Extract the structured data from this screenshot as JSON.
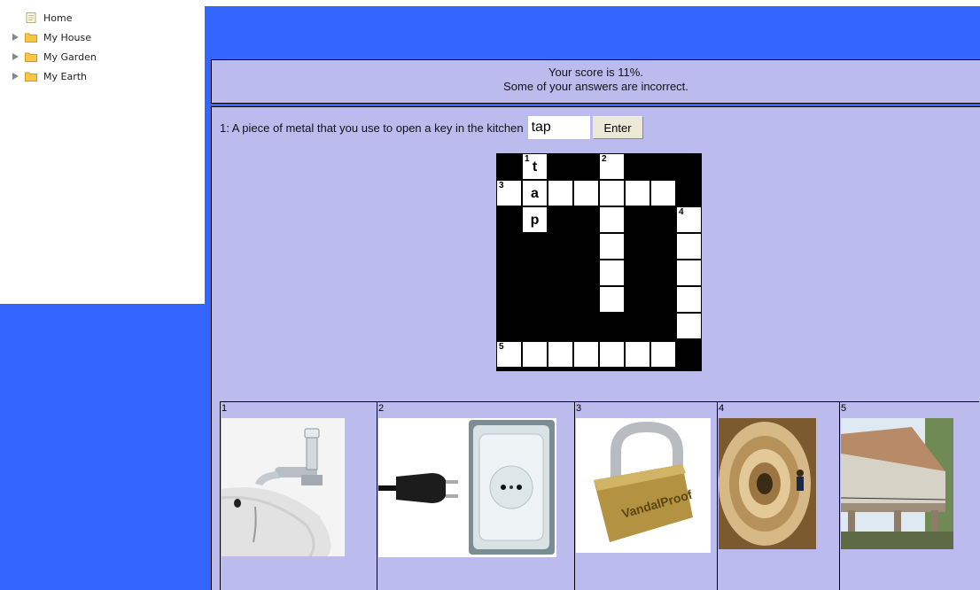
{
  "nav": {
    "items": [
      {
        "label": "Home",
        "icon": "page-icon",
        "expandable": false
      },
      {
        "label": "My House",
        "icon": "folder-icon",
        "expandable": true
      },
      {
        "label": "My Garden",
        "icon": "folder-icon",
        "expandable": true
      },
      {
        "label": "My Earth",
        "icon": "folder-icon",
        "expandable": true
      }
    ]
  },
  "score": {
    "line1": "Your score is 11%.",
    "line2": "Some of your answers are incorrect."
  },
  "clue": {
    "text": "1: A piece of metal that you use to open a key in the kitchen",
    "answer_value": "tap",
    "enter_label": "Enter"
  },
  "crossword": {
    "numbers": {
      "n1": "1",
      "n2": "2",
      "n3": "3",
      "n4": "4",
      "n5": "5"
    },
    "letters": {
      "r0c1": "t",
      "r1c1": "a",
      "r2c1": "p"
    }
  },
  "pictures": [
    {
      "num": "1",
      "subject": "tap-image"
    },
    {
      "num": "2",
      "subject": "plug-and-socket-image"
    },
    {
      "num": "3",
      "subject": "padlock-image"
    },
    {
      "num": "4",
      "subject": "spiral-staircase-image"
    },
    {
      "num": "5",
      "subject": "house-balcony-image"
    }
  ],
  "colors": {
    "accent_blue": "#3366ff",
    "panel_lavender": "#bbbbee"
  }
}
